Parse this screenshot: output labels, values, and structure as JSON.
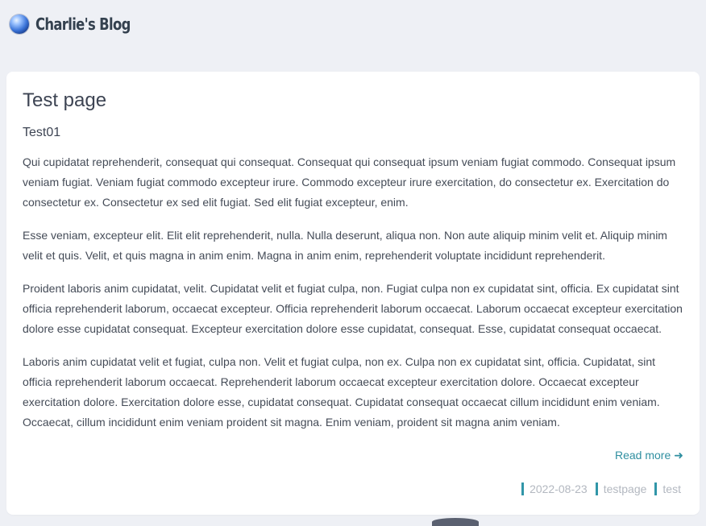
{
  "header": {
    "site_title": "Charlie's Blog",
    "logo_icon": "blue-orb-icon"
  },
  "post": {
    "title": "Test page",
    "subtitle": "Test01",
    "paragraphs": [
      "Qui cupidatat reprehenderit, consequat qui consequat. Consequat qui consequat ipsum veniam fugiat commodo. Consequat ipsum veniam fugiat. Veniam fugiat commodo excepteur irure. Commodo excepteur irure exercitation, do consectetur ex. Exercitation do consectetur ex. Consectetur ex sed elit fugiat. Sed elit fugiat excepteur, enim.",
      "Esse veniam, excepteur elit. Elit elit reprehenderit, nulla. Nulla deserunt, aliqua non. Non aute aliquip minim velit et. Aliquip minim velit et quis. Velit, et quis magna in anim enim. Magna in anim enim, reprehenderit voluptate incididunt reprehenderit.",
      "Proident laboris anim cupidatat, velit. Cupidatat velit et fugiat culpa, non. Fugiat culpa non ex cupidatat sint, officia. Ex cupidatat sint officia reprehenderit laborum, occaecat excepteur. Officia reprehenderit laborum occaecat. Laborum occaecat excepteur exercitation dolore esse cupidatat consequat. Excepteur exercitation dolore esse cupidatat, consequat. Esse, cupidatat consequat occaecat.",
      "Laboris anim cupidatat velit et fugiat, culpa non. Velit et fugiat culpa, non ex. Culpa non ex cupidatat sint, officia. Cupidatat, sint officia reprehenderit laborum occaecat. Reprehenderit laborum occaecat excepteur exercitation dolore. Occaecat excepteur exercitation dolore. Exercitation dolore esse, cupidatat consequat. Cupidatat consequat occaecat cillum incididunt enim veniam. Occaecat, cillum incididunt enim veniam proident sit magna. Enim veniam, proident sit magna anim veniam."
    ],
    "read_more_label": "Read more",
    "read_more_icon": "arrow-right-icon",
    "meta": {
      "date": "2022-08-23",
      "tags": [
        "testpage",
        "test"
      ]
    }
  },
  "colors": {
    "accent": "#3196a8",
    "background": "#eef0f5",
    "card": "#ffffff",
    "meta_text": "#b3b8c0"
  }
}
